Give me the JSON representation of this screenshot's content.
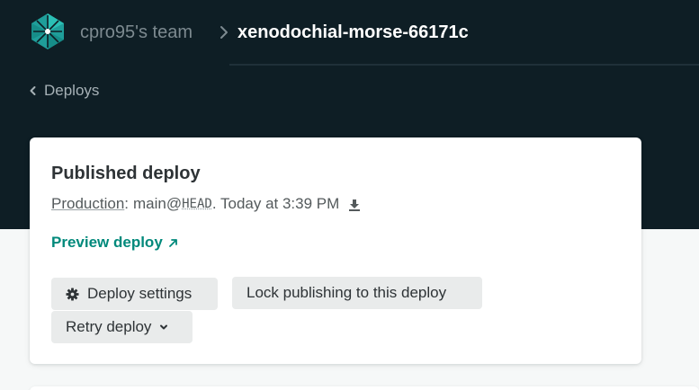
{
  "header": {
    "team_name": "cpro95's team",
    "site_name": "xenodochial-morse-66171c"
  },
  "back_link": {
    "label": "Deploys"
  },
  "deploy_card": {
    "title": "Published deploy",
    "context_label": "Production",
    "colon": ":",
    "branch": "main@",
    "ref": "HEAD",
    "time_text": ". Today at 3:39 PM",
    "preview_label": "Preview deploy",
    "buttons": {
      "settings": "Deploy settings",
      "lock": "Lock publishing to this deploy",
      "retry": "Retry deploy"
    }
  },
  "icons": {
    "logo": "netlify-logo-icon",
    "breadcrumb_separator": "chevron-right-icon",
    "back": "chevron-left-icon",
    "download": "download-icon",
    "external": "arrow-up-right-icon",
    "settings": "gear-icon",
    "dropdown": "chevron-down-icon"
  },
  "colors": {
    "header_bg": "#0e1e25",
    "accent": "#00897b",
    "page_bg": "#f6f8f8",
    "button_bg": "#e9ebeb"
  }
}
